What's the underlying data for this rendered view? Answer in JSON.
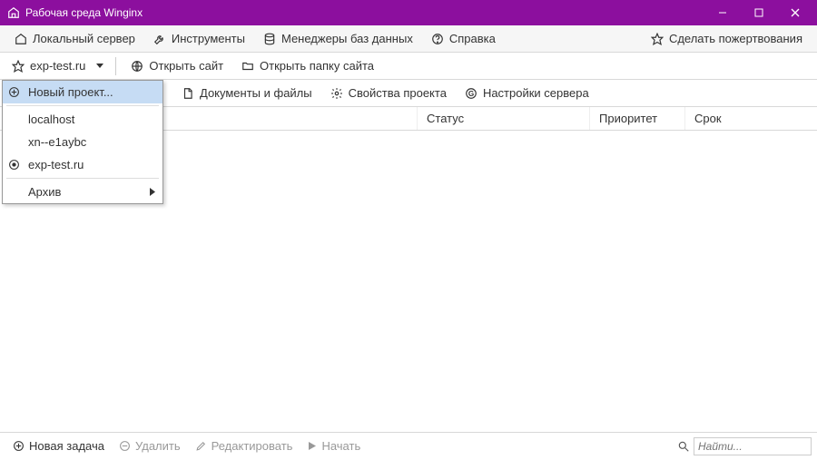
{
  "window": {
    "title": "Рабочая среда Winginx"
  },
  "menubar": {
    "local_server": "Локальный сервер",
    "tools": "Инструменты",
    "db_managers": "Менеджеры баз данных",
    "help": "Справка",
    "donate": "Сделать пожертвования"
  },
  "toolbar2": {
    "project": "exp-test.ru",
    "open_site": "Открыть сайт",
    "open_folder": "Открыть папку сайта"
  },
  "toolbar3": {
    "docs_files": "Документы и файлы",
    "project_props": "Свойства проекта",
    "server_settings": "Настройки сервера"
  },
  "table_headers": {
    "col1": "",
    "col2": "Статус",
    "col3": "Приоритет",
    "col4": "Срок"
  },
  "dropdown": {
    "new_project": "Новый проект...",
    "items": [
      "localhost",
      "xn--e1aybc",
      "exp-test.ru"
    ],
    "archive": "Архив"
  },
  "bottombar": {
    "new_task": "Новая задача",
    "delete": "Удалить",
    "edit": "Редактировать",
    "start": "Начать",
    "search_placeholder": "Найти..."
  }
}
